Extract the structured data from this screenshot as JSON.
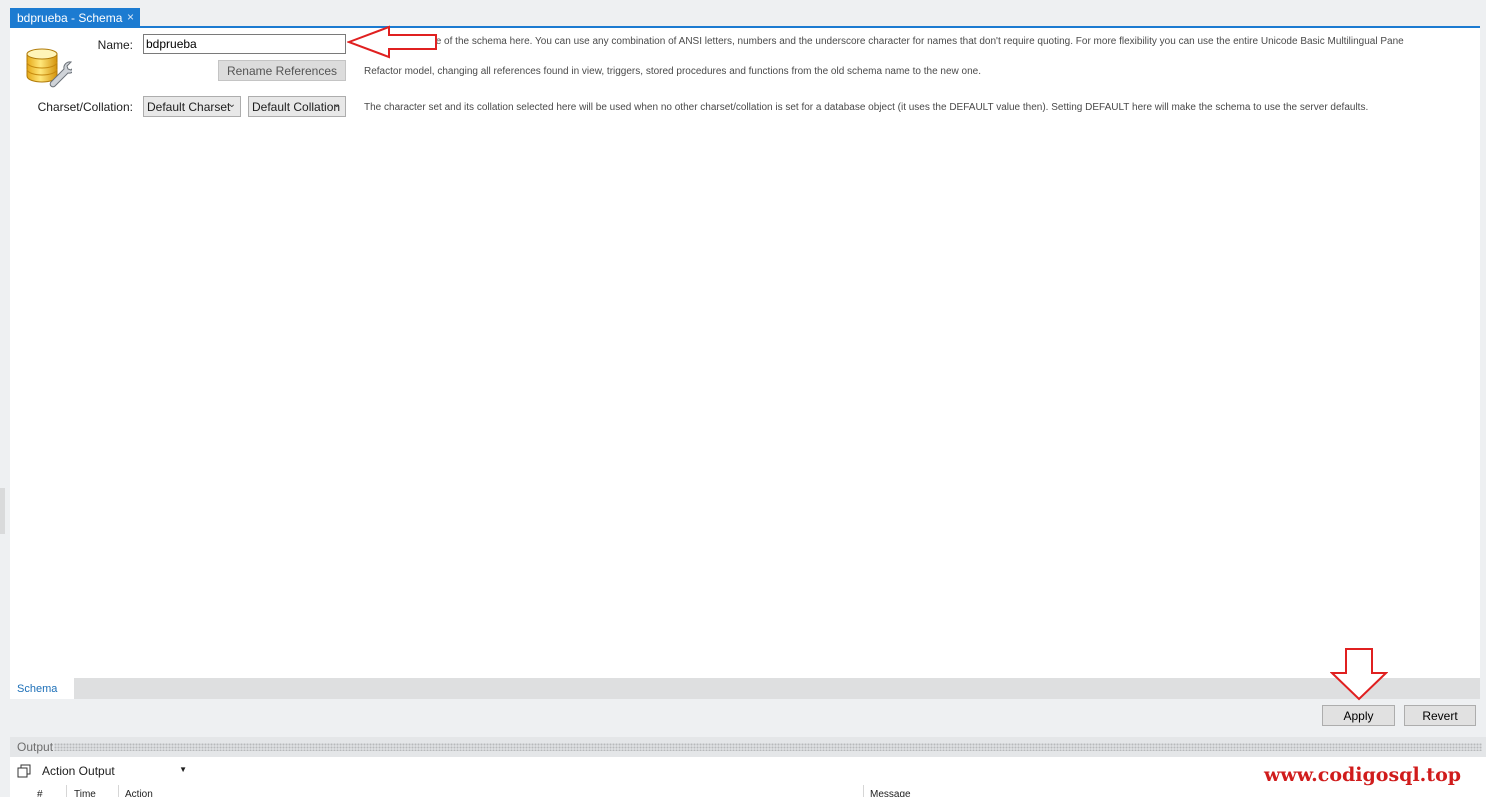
{
  "tab": {
    "title": "bdprueba - Schema",
    "close": "×"
  },
  "form": {
    "name_label": "Name:",
    "name_value": "bdprueba",
    "rename_button": "Rename References",
    "charset_label": "Charset/Collation:",
    "charset_value": "Default Charset",
    "collation_value": "Default Collation"
  },
  "hints": {
    "name": "Specify the name of the schema here. You can use any combination of ANSI letters, numbers and the underscore character for names that don't require quoting. For more flexibility you can use the entire Unicode Basic Multilingual Pane",
    "rename": "Refactor model, changing all references found in view, triggers, stored procedures and functions from the old schema name to the new one.",
    "charset": "The character set and its collation selected here will be used when no other charset/collation is set for a database object (it uses the DEFAULT value then). Setting DEFAULT here will make the schema to use the server defaults."
  },
  "subtabs": {
    "schema": "Schema"
  },
  "buttons": {
    "apply": "Apply",
    "revert": "Revert"
  },
  "output": {
    "title": "Output",
    "selector": "Action Output",
    "columns": {
      "num": "#",
      "time": "Time",
      "action": "Action",
      "message": "Message"
    }
  },
  "watermark": "www.codigosql.top",
  "colors": {
    "accent": "#1c7bd1",
    "annotation": "#e02020",
    "watermark": "#d01c1c"
  },
  "icons": [
    "database-wrench-icon",
    "close-icon",
    "chevron-down-icon",
    "copy-icon",
    "red-arrow-left-icon",
    "red-arrow-down-icon"
  ]
}
